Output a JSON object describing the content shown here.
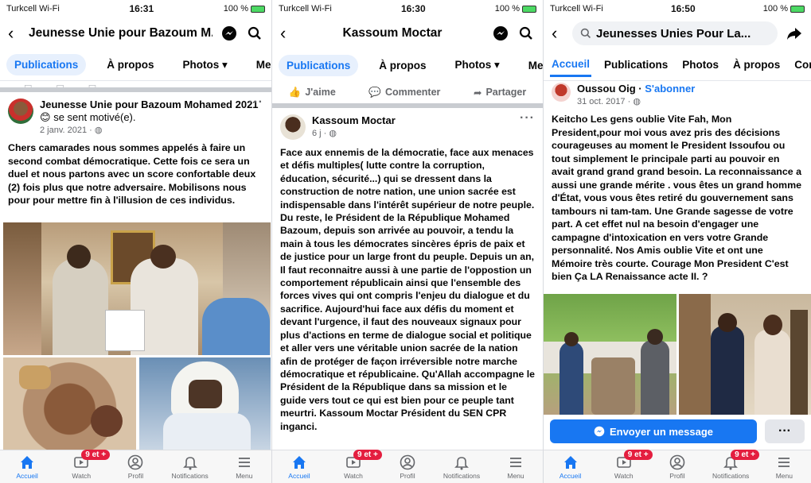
{
  "panel1": {
    "status": {
      "carrier": "Turkcell Wi-Fi",
      "time": "16:31",
      "battery": "100 %"
    },
    "header_title": "Jeunesse Unie pour Bazoum M...",
    "tabs": [
      "Publications",
      "À propos",
      "Photos ▾",
      "Menti"
    ],
    "post": {
      "author": "Jeunesse Unie pour Bazoum Mohamed 2021",
      "feeling": "se sent motivé(e).",
      "date": "2 janv. 2021 · ",
      "text": "Chers camarades nous sommes appelés à faire un second combat démocratique. Cette fois ce sera un duel et nous partons avec un score confortable deux (2) fois plus que notre adversaire. Mobilisons nous pour pour mettre fin à l'illusion de ces individus."
    }
  },
  "panel2": {
    "status": {
      "carrier": "Turkcell Wi-Fi",
      "time": "16:30",
      "battery": "100 %"
    },
    "header_title": "Kassoum Moctar",
    "tabs": [
      "Publications",
      "À propos",
      "Photos ▾",
      "Menti"
    ],
    "actions": {
      "like": "J'aime",
      "comment": "Commenter",
      "share": "Partager"
    },
    "post": {
      "author": "Kassoum Moctar",
      "date": "6 j · ",
      "text": "Face aux ennemis de la démocratie, face aux menaces et défis multiples( lutte contre la corruption, éducation, sécurité...) qui se dressent dans la construction de notre nation, une union sacrée est indispensable dans l'intérêt supérieur de notre peuple. Du reste, le Président de la République Mohamed Bazoum, depuis son arrivée au pouvoir, a tendu la main à tous les démocrates sincères épris de paix et de justice pour un large front du peuple. Depuis un an, Il faut reconnaitre aussi à une partie de l'oppostion un comportement républicain ainsi que l'ensemble des forces vives qui ont compris l'enjeu du dialogue et du sacrifice. Aujourd'hui face aux défis du moment et devant l'urgence, il faut des nouveaux signaux pour plus d'actions en terme de dialogue social et politique et aller vers une véritable union sacrée de la nation afin de protéger de façon irréversible notre marche démocratique et républicaine. Qu'Allah accompagne le Président de la République dans sa mission et le guide vers tout ce qui est bien pour ce peuple tant meurtri. Kassoum Moctar Président du SEN CPR inganci."
    }
  },
  "panel3": {
    "status": {
      "carrier": "Turkcell Wi-Fi",
      "time": "16:50",
      "battery": "100 %"
    },
    "search_value": "Jeunesses Unies Pour La...",
    "tabs": [
      "Accueil",
      "Publications",
      "Photos",
      "À propos",
      "Cor"
    ],
    "post": {
      "author": "Oussou Oig",
      "subscribe": "S'abonner",
      "date": "31 oct. 2017 · ",
      "text": "Keitcho Les gens oublie Vite Fah, Mon President,pour moi vous avez pris des décisions courageuses au moment le President Issoufou ou tout simplement le principale parti au pouvoir en avait grand grand grand besoin. La reconnaissance a aussi une grande mérite . vous êtes un grand homme d'État, vous vous êtes retiré du gouvernement sans tambours ni tam-tam. Une Grande sagesse de votre part. A cet effet nul na besoin d'engager une campagne d'intoxication en vers votre Grande personnalité. Nos Amis oublie Vite et ont une Mémoire très courte. Courage Mon President C'est bien Ça LA Renaissance acte II. ?"
    },
    "message_button": "Envoyer un message",
    "more_button": "···"
  },
  "bottom_nav": {
    "items": [
      "Accueil",
      "Watch",
      "Profil",
      "Notifications",
      "Menu"
    ],
    "badge": "9 et +"
  },
  "colors": {
    "accent": "#1877f2",
    "badge": "#e41e3f"
  }
}
